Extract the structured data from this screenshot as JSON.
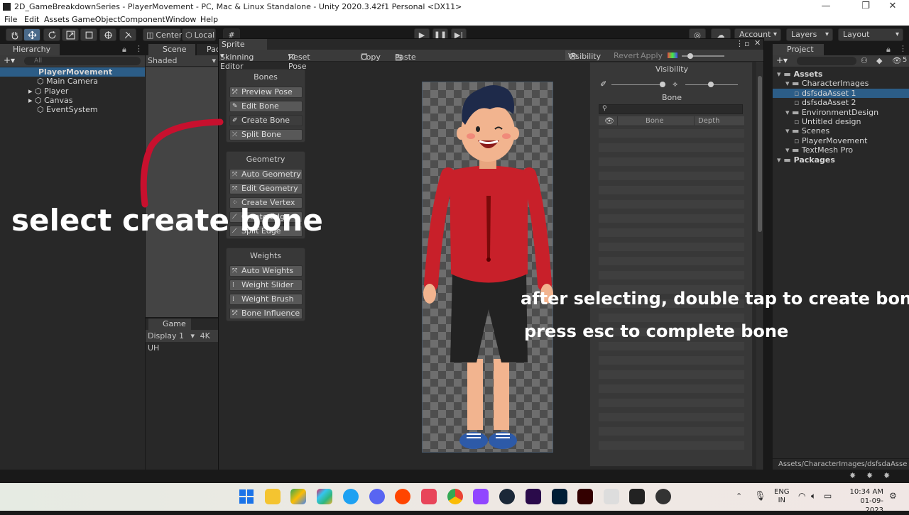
{
  "window": {
    "title": "2D_GameBreakdownSeries - PlayerMovement - PC, Mac & Linux Standalone - Unity 2020.3.42f1 Personal <DX11>",
    "controls": [
      "—",
      "❐",
      "✕"
    ]
  },
  "menu": [
    "File",
    "Edit",
    "Assets",
    "GameObject",
    "Component",
    "Window",
    "Help"
  ],
  "toolbar": {
    "pivot": "Center",
    "space": "Local",
    "account": "Account",
    "layers": "Layers",
    "layout": "Layout"
  },
  "hierarchy": {
    "tab": "Hierarchy",
    "search_placeholder": "All",
    "scene": "PlayerMovement",
    "items": [
      "Main Camera",
      "Player",
      "Canvas",
      "EventSystem"
    ]
  },
  "scene_panel": {
    "tab": "Scene",
    "tab2": "Pac",
    "mode": "Shaded"
  },
  "game_panel": {
    "tab": "Game",
    "display": "Display 1",
    "resolution": "4K UH"
  },
  "sprite_editor": {
    "tab": "Sprite Editor",
    "mode": "Skinning Editor",
    "reset_pose": "Reset Pose",
    "copy": "Copy",
    "paste": "Paste",
    "visibility": "Visibility",
    "revert": "Revert",
    "apply": "Apply",
    "bones": {
      "title": "Bones",
      "buttons": [
        "Preview Pose",
        "Edit Bone",
        "Create Bone",
        "Split Bone"
      ]
    },
    "geometry": {
      "title": "Geometry",
      "buttons": [
        "Auto Geometry",
        "Edit Geometry",
        "Create Vertex",
        "Create Edge",
        "Split Edge"
      ]
    },
    "weights": {
      "title": "Weights",
      "buttons": [
        "Auto Weights",
        "Weight Slider",
        "Weight Brush",
        "Bone Influence"
      ]
    }
  },
  "visibility_panel": {
    "title": "Visibility",
    "section": "Bone",
    "col_bone": "Bone",
    "col_depth": "Depth"
  },
  "project": {
    "tab": "Project",
    "layers_count": "5",
    "path": "Assets/CharacterImages/dsfsdaAsse",
    "tree": [
      {
        "label": "Assets",
        "level": 0,
        "bold": true
      },
      {
        "label": "CharacterImages",
        "level": 1
      },
      {
        "label": "dsfsdaAsset 1",
        "level": 2,
        "selected": true
      },
      {
        "label": "dsfsdaAsset 2",
        "level": 2
      },
      {
        "label": "EnvironmentDesign",
        "level": 1
      },
      {
        "label": "Untitled design",
        "level": 2
      },
      {
        "label": "Scenes",
        "level": 1
      },
      {
        "label": "PlayerMovement",
        "level": 2
      },
      {
        "label": "TextMesh Pro",
        "level": 1
      },
      {
        "label": "Packages",
        "level": 0,
        "bold": true
      }
    ]
  },
  "captions": {
    "left": "select create bone",
    "right1": "after selecting, double tap to create bone",
    "right2": "press esc to complete bone"
  },
  "taskbar": {
    "lang1": "ENG",
    "lang2": "IN",
    "time": "10:34 AM",
    "date": "01-09-2023"
  },
  "colors": {
    "accent_selected": "#2c5d87",
    "arrow": "#c8102e",
    "shirt": "#c8202a"
  }
}
